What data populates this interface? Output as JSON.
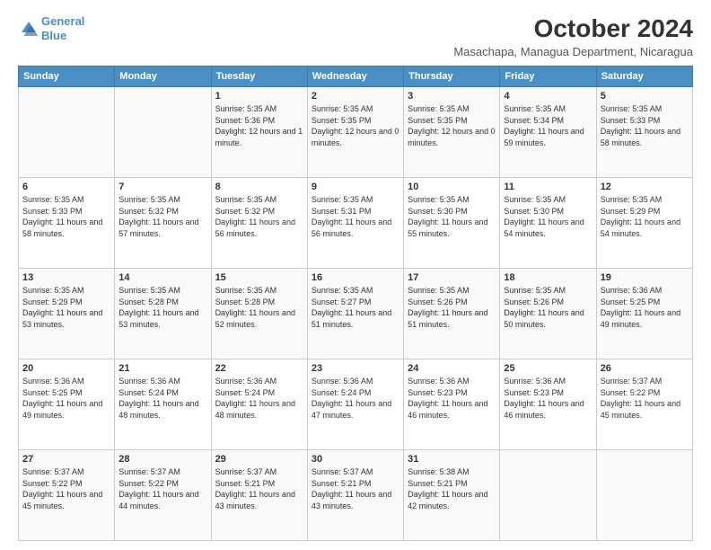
{
  "header": {
    "logo_line1": "General",
    "logo_line2": "Blue",
    "main_title": "October 2024",
    "subtitle": "Masachapa, Managua Department, Nicaragua"
  },
  "weekdays": [
    "Sunday",
    "Monday",
    "Tuesday",
    "Wednesday",
    "Thursday",
    "Friday",
    "Saturday"
  ],
  "weeks": [
    [
      {
        "num": "",
        "sunrise": "",
        "sunset": "",
        "daylight": ""
      },
      {
        "num": "",
        "sunrise": "",
        "sunset": "",
        "daylight": ""
      },
      {
        "num": "1",
        "sunrise": "Sunrise: 5:35 AM",
        "sunset": "Sunset: 5:36 PM",
        "daylight": "Daylight: 12 hours and 1 minute."
      },
      {
        "num": "2",
        "sunrise": "Sunrise: 5:35 AM",
        "sunset": "Sunset: 5:35 PM",
        "daylight": "Daylight: 12 hours and 0 minutes."
      },
      {
        "num": "3",
        "sunrise": "Sunrise: 5:35 AM",
        "sunset": "Sunset: 5:35 PM",
        "daylight": "Daylight: 12 hours and 0 minutes."
      },
      {
        "num": "4",
        "sunrise": "Sunrise: 5:35 AM",
        "sunset": "Sunset: 5:34 PM",
        "daylight": "Daylight: 11 hours and 59 minutes."
      },
      {
        "num": "5",
        "sunrise": "Sunrise: 5:35 AM",
        "sunset": "Sunset: 5:33 PM",
        "daylight": "Daylight: 11 hours and 58 minutes."
      }
    ],
    [
      {
        "num": "6",
        "sunrise": "Sunrise: 5:35 AM",
        "sunset": "Sunset: 5:33 PM",
        "daylight": "Daylight: 11 hours and 58 minutes."
      },
      {
        "num": "7",
        "sunrise": "Sunrise: 5:35 AM",
        "sunset": "Sunset: 5:32 PM",
        "daylight": "Daylight: 11 hours and 57 minutes."
      },
      {
        "num": "8",
        "sunrise": "Sunrise: 5:35 AM",
        "sunset": "Sunset: 5:32 PM",
        "daylight": "Daylight: 11 hours and 56 minutes."
      },
      {
        "num": "9",
        "sunrise": "Sunrise: 5:35 AM",
        "sunset": "Sunset: 5:31 PM",
        "daylight": "Daylight: 11 hours and 56 minutes."
      },
      {
        "num": "10",
        "sunrise": "Sunrise: 5:35 AM",
        "sunset": "Sunset: 5:30 PM",
        "daylight": "Daylight: 11 hours and 55 minutes."
      },
      {
        "num": "11",
        "sunrise": "Sunrise: 5:35 AM",
        "sunset": "Sunset: 5:30 PM",
        "daylight": "Daylight: 11 hours and 54 minutes."
      },
      {
        "num": "12",
        "sunrise": "Sunrise: 5:35 AM",
        "sunset": "Sunset: 5:29 PM",
        "daylight": "Daylight: 11 hours and 54 minutes."
      }
    ],
    [
      {
        "num": "13",
        "sunrise": "Sunrise: 5:35 AM",
        "sunset": "Sunset: 5:29 PM",
        "daylight": "Daylight: 11 hours and 53 minutes."
      },
      {
        "num": "14",
        "sunrise": "Sunrise: 5:35 AM",
        "sunset": "Sunset: 5:28 PM",
        "daylight": "Daylight: 11 hours and 53 minutes."
      },
      {
        "num": "15",
        "sunrise": "Sunrise: 5:35 AM",
        "sunset": "Sunset: 5:28 PM",
        "daylight": "Daylight: 11 hours and 52 minutes."
      },
      {
        "num": "16",
        "sunrise": "Sunrise: 5:35 AM",
        "sunset": "Sunset: 5:27 PM",
        "daylight": "Daylight: 11 hours and 51 minutes."
      },
      {
        "num": "17",
        "sunrise": "Sunrise: 5:35 AM",
        "sunset": "Sunset: 5:26 PM",
        "daylight": "Daylight: 11 hours and 51 minutes."
      },
      {
        "num": "18",
        "sunrise": "Sunrise: 5:35 AM",
        "sunset": "Sunset: 5:26 PM",
        "daylight": "Daylight: 11 hours and 50 minutes."
      },
      {
        "num": "19",
        "sunrise": "Sunrise: 5:36 AM",
        "sunset": "Sunset: 5:25 PM",
        "daylight": "Daylight: 11 hours and 49 minutes."
      }
    ],
    [
      {
        "num": "20",
        "sunrise": "Sunrise: 5:36 AM",
        "sunset": "Sunset: 5:25 PM",
        "daylight": "Daylight: 11 hours and 49 minutes."
      },
      {
        "num": "21",
        "sunrise": "Sunrise: 5:36 AM",
        "sunset": "Sunset: 5:24 PM",
        "daylight": "Daylight: 11 hours and 48 minutes."
      },
      {
        "num": "22",
        "sunrise": "Sunrise: 5:36 AM",
        "sunset": "Sunset: 5:24 PM",
        "daylight": "Daylight: 11 hours and 48 minutes."
      },
      {
        "num": "23",
        "sunrise": "Sunrise: 5:36 AM",
        "sunset": "Sunset: 5:24 PM",
        "daylight": "Daylight: 11 hours and 47 minutes."
      },
      {
        "num": "24",
        "sunrise": "Sunrise: 5:36 AM",
        "sunset": "Sunset: 5:23 PM",
        "daylight": "Daylight: 11 hours and 46 minutes."
      },
      {
        "num": "25",
        "sunrise": "Sunrise: 5:36 AM",
        "sunset": "Sunset: 5:23 PM",
        "daylight": "Daylight: 11 hours and 46 minutes."
      },
      {
        "num": "26",
        "sunrise": "Sunrise: 5:37 AM",
        "sunset": "Sunset: 5:22 PM",
        "daylight": "Daylight: 11 hours and 45 minutes."
      }
    ],
    [
      {
        "num": "27",
        "sunrise": "Sunrise: 5:37 AM",
        "sunset": "Sunset: 5:22 PM",
        "daylight": "Daylight: 11 hours and 45 minutes."
      },
      {
        "num": "28",
        "sunrise": "Sunrise: 5:37 AM",
        "sunset": "Sunset: 5:22 PM",
        "daylight": "Daylight: 11 hours and 44 minutes."
      },
      {
        "num": "29",
        "sunrise": "Sunrise: 5:37 AM",
        "sunset": "Sunset: 5:21 PM",
        "daylight": "Daylight: 11 hours and 43 minutes."
      },
      {
        "num": "30",
        "sunrise": "Sunrise: 5:37 AM",
        "sunset": "Sunset: 5:21 PM",
        "daylight": "Daylight: 11 hours and 43 minutes."
      },
      {
        "num": "31",
        "sunrise": "Sunrise: 5:38 AM",
        "sunset": "Sunset: 5:21 PM",
        "daylight": "Daylight: 11 hours and 42 minutes."
      },
      {
        "num": "",
        "sunrise": "",
        "sunset": "",
        "daylight": ""
      },
      {
        "num": "",
        "sunrise": "",
        "sunset": "",
        "daylight": ""
      }
    ]
  ]
}
